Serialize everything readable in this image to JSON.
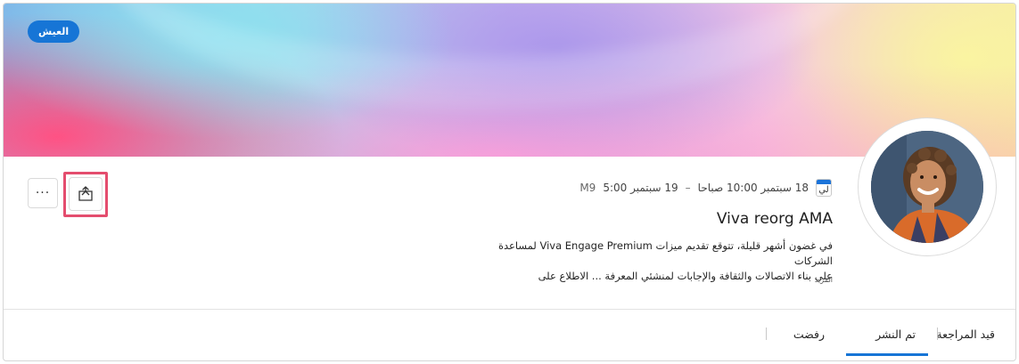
{
  "banner": {
    "pill_label": "العيش"
  },
  "event": {
    "calendar_icon_text": "لي",
    "start": "18 سبتمبر 10:00 صباحا",
    "separator": "–",
    "end": "19 سبتمبر 5:00",
    "timezone": "M9",
    "title": "Viva reorg AMA",
    "description_line1": "في غضون أشهر قليلة، تتوقع تقديم ميزات Viva Engage Premium لمساعدة الشركات",
    "description_line2": "على بناء الاتصالات والثقافة والإجابات لمنشئي المعرفة ... الاطلاع على",
    "more_label": "المزيد"
  },
  "actions": {
    "more_icon": "more-horizontal-icon",
    "more_glyph": "···",
    "share_icon": "share-icon"
  },
  "tabs": [
    {
      "label": "قيد المراجعة"
    },
    {
      "label": "تم النشر",
      "selected": true
    },
    {
      "label": "رفضت"
    }
  ],
  "colors": {
    "accent": "#1675d6",
    "highlight": "#e44d6e"
  }
}
